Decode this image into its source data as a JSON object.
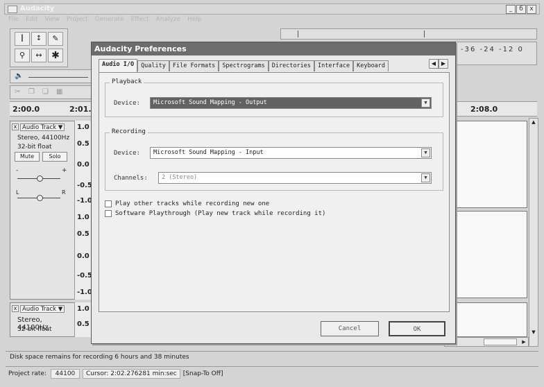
{
  "window": {
    "title": "Audacity",
    "controls": [
      "_",
      "б",
      "x"
    ]
  },
  "menu": [
    "File",
    "Edit",
    "View",
    "Project",
    "Generate",
    "Effect",
    "Analyze",
    "Help"
  ],
  "meter_text": "-36  -24  -12  0",
  "ruler": [
    "2:00.0",
    "2:01.",
    "2:08.0"
  ],
  "tracks": [
    {
      "close": "x",
      "name": "Audio Track ▼",
      "info1": "Stereo, 44100Hz",
      "info2": "32-bit float",
      "mute": "Mute",
      "solo": "Solo",
      "gain_minus": "-",
      "gain_plus": "+",
      "pan_l": "L",
      "pan_r": "R",
      "scale": [
        "1.0",
        "0.5",
        "0.0",
        "-0.5",
        "-1.0",
        "1.0",
        "0.5",
        "0.0",
        "-0.5",
        "-1.0"
      ]
    },
    {
      "close": "x",
      "name": "Audio Track ▼",
      "info1": "Stereo, 44100Hz",
      "info2": "32-bit float",
      "scale": [
        "1.0",
        "0.5"
      ]
    }
  ],
  "status": {
    "disk": "Disk space remains for recording 6 hours and 38 minutes",
    "rate_label": "Project rate:",
    "rate_value": "44100",
    "cursor": "Cursor: 2:02.276281 min:sec",
    "snap": "[Snap-To Off]"
  },
  "dialog": {
    "title": "Audacity Preferences",
    "tabs": [
      "Audio I/O",
      "Quality",
      "File Formats",
      "Spectrograms",
      "Directories",
      "Interface",
      "Keyboard"
    ],
    "playback": {
      "legend": "Playback",
      "device_label": "Device:",
      "device_value": "Microsoft Sound Mapping - Output"
    },
    "recording": {
      "legend": "Recording",
      "device_label": "Device:",
      "device_value": "Microsoft Sound Mapping - Input",
      "channels_label": "Channels:",
      "channels_value": "2 (Stereo)"
    },
    "checks": [
      "Play other tracks while recording new one",
      "Software Playthrough (Play new track while recording it)"
    ],
    "cancel": "Cancel",
    "ok": "OK"
  }
}
